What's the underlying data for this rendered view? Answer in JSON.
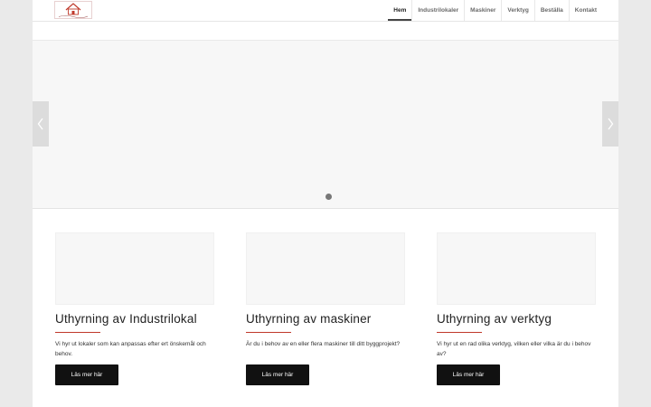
{
  "header": {
    "logo_icon": "house-logo-icon",
    "nav": [
      {
        "label": "Hem",
        "active": true
      },
      {
        "label": "Industrilokaler",
        "active": false
      },
      {
        "label": "Maskiner",
        "active": false
      },
      {
        "label": "Verktyg",
        "active": false
      },
      {
        "label": "Beställa",
        "active": false
      },
      {
        "label": "Kontakt",
        "active": false
      }
    ]
  },
  "slider": {
    "prev_icon": "chevron-left-icon",
    "next_icon": "chevron-right-icon",
    "slide_count": 1
  },
  "cards": [
    {
      "title": "Uthyrning av Industrilokal",
      "text": "Vi hyr ut lokaler som kan anpassas efter ert önskemål och behov.",
      "button": "Läs mer här"
    },
    {
      "title": "Uthyrning av maskiner",
      "text": "Är du i behov av en eller flera maskiner till ditt byggprojekt?",
      "button": "Läs mer här"
    },
    {
      "title": "Uthyrning av verktyg",
      "text": "Vi hyr ut en rad olika verktyg, vilken eller vilka är du i behov av?",
      "button": "Läs mer här"
    }
  ],
  "colors": {
    "accent_rule": "#c0392b",
    "button_bg": "#111111",
    "logo_red": "#c0392b"
  }
}
